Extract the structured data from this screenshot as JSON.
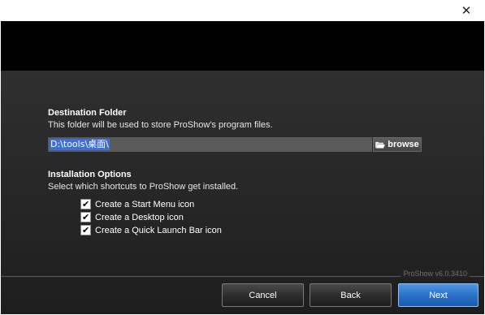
{
  "window": {
    "close_glyph": "✕"
  },
  "destination": {
    "title": "Destination Folder",
    "description": "This folder will be used to store ProShow's program files.",
    "path_value": "D:\\tools\\桌面\\",
    "browse_label": "browse"
  },
  "options": {
    "title": "Installation Options",
    "description": "Select which shortcuts to ProShow get installed.",
    "items": [
      {
        "label": "Create a Start Menu icon",
        "checked": true
      },
      {
        "label": "Create a Desktop icon",
        "checked": true
      },
      {
        "label": "Create a Quick Launch Bar icon",
        "checked": true
      }
    ]
  },
  "version_text": "ProShow v6.0.3410",
  "buttons": {
    "cancel": "Cancel",
    "back": "Back",
    "next": "Next"
  },
  "colors": {
    "accent": "#2b73c9",
    "banner": "#000000",
    "body_bg": "#2a2a2a"
  }
}
